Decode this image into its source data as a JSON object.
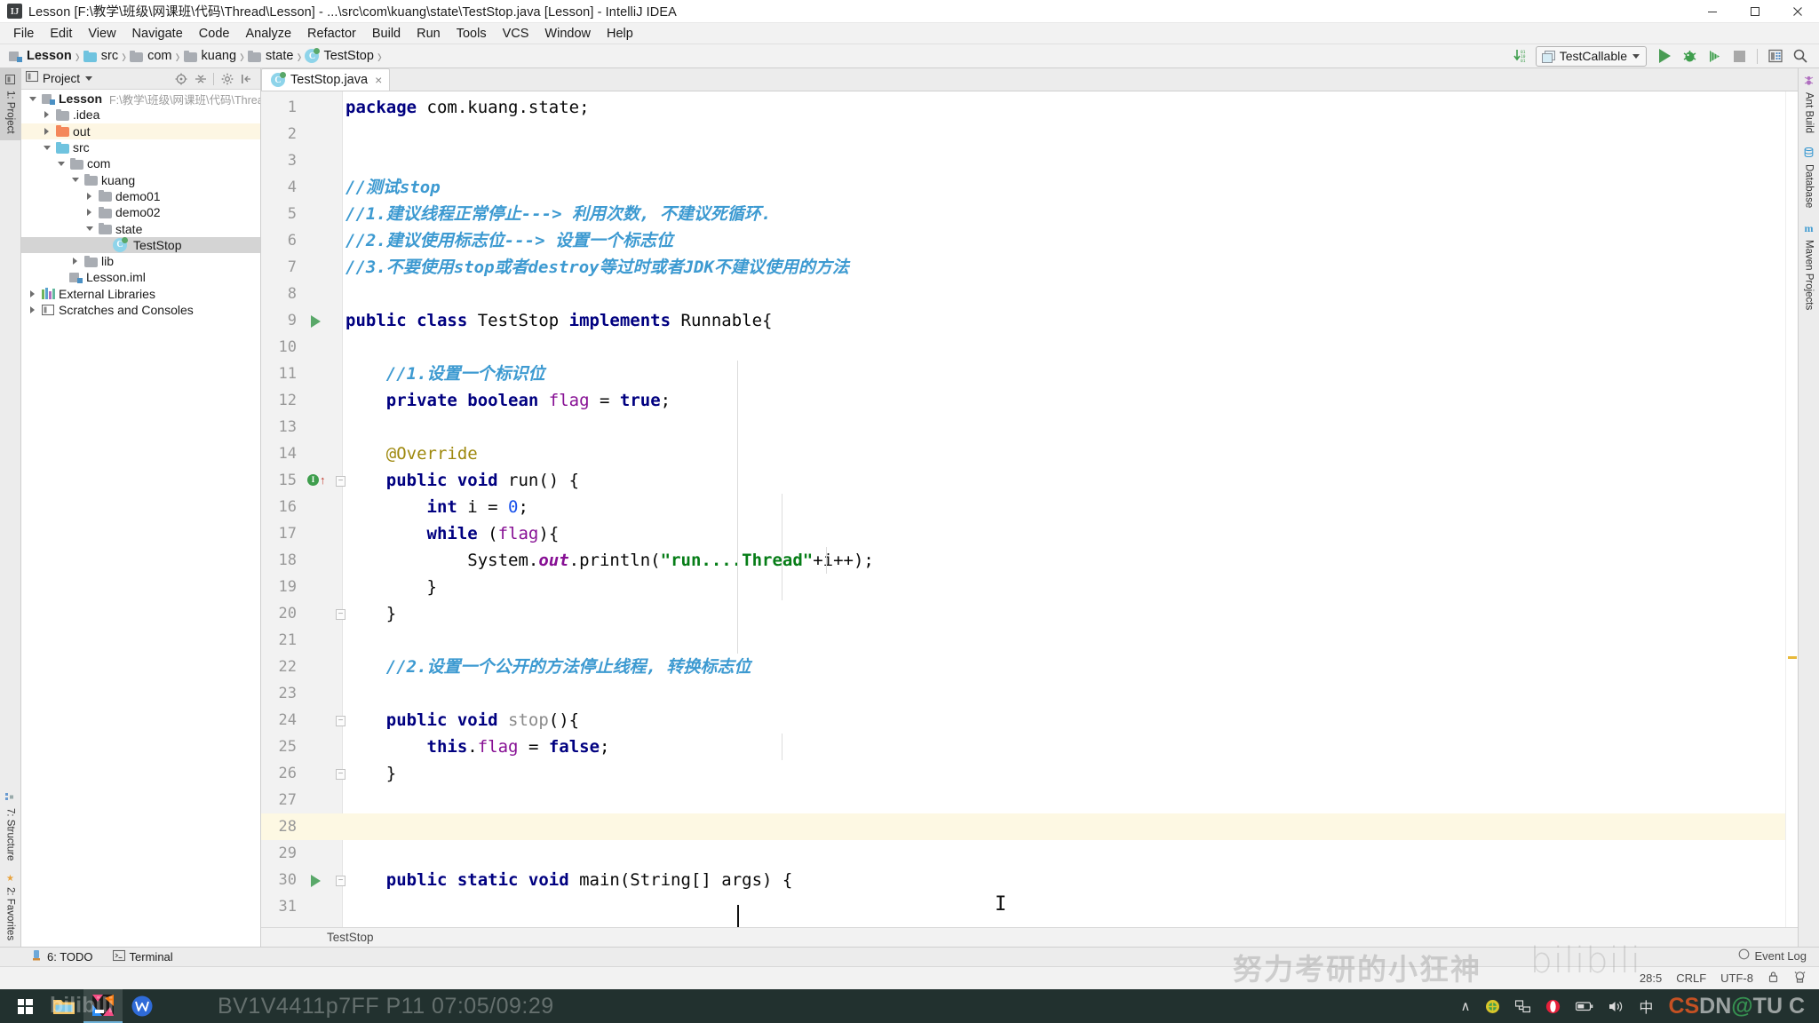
{
  "window": {
    "title": "Lesson [F:\\教学\\班级\\网课班\\代码\\Thread\\Lesson] - ...\\src\\com\\kuang\\state\\TestStop.java [Lesson] - IntelliJ IDEA",
    "app_icon": "intellij-idea-icon",
    "minimize_label": "Minimize",
    "maximize_label": "Maximize",
    "close_label": "Close"
  },
  "menubar": {
    "items": [
      {
        "label": "File"
      },
      {
        "label": "Edit"
      },
      {
        "label": "View"
      },
      {
        "label": "Navigate"
      },
      {
        "label": "Code"
      },
      {
        "label": "Analyze"
      },
      {
        "label": "Refactor"
      },
      {
        "label": "Build"
      },
      {
        "label": "Run"
      },
      {
        "label": "Tools"
      },
      {
        "label": "VCS"
      },
      {
        "label": "Window"
      },
      {
        "label": "Help"
      }
    ]
  },
  "navbar": {
    "breadcrumbs": [
      {
        "label": "Lesson",
        "icon": "module-icon"
      },
      {
        "label": "src",
        "icon": "source-folder-icon"
      },
      {
        "label": "com",
        "icon": "package-icon"
      },
      {
        "label": "kuang",
        "icon": "package-icon"
      },
      {
        "label": "state",
        "icon": "package-icon"
      },
      {
        "label": "TestStop",
        "icon": "java-class-icon"
      }
    ],
    "separator": "›",
    "run_config": "TestCallable",
    "buttons": [
      {
        "name": "compile-button",
        "label": "Build"
      },
      {
        "name": "run-button",
        "label": "Run"
      },
      {
        "name": "debug-button",
        "label": "Debug"
      },
      {
        "name": "run-coverage-button",
        "label": "Run with Coverage"
      },
      {
        "name": "stop-button",
        "label": "Stop"
      },
      {
        "name": "project-structure-button",
        "label": "Project Structure"
      },
      {
        "name": "search-everywhere-button",
        "label": "Search Everywhere"
      }
    ]
  },
  "left_rail": {
    "top": [
      {
        "label": "1: Project",
        "icon": "project-icon",
        "active": true
      }
    ],
    "bottom": [
      {
        "label": "7: Structure",
        "icon": "structure-icon"
      },
      {
        "label": "2: Favorites",
        "icon": "favorites-star-icon"
      }
    ]
  },
  "right_rail": {
    "items": [
      {
        "label": "Ant Build",
        "icon": "ant-icon"
      },
      {
        "label": "Database",
        "icon": "database-icon"
      },
      {
        "label": "Maven Projects",
        "icon": "maven-icon"
      }
    ]
  },
  "project_panel": {
    "title": "Project",
    "header_icons": [
      {
        "name": "locate-icon"
      },
      {
        "name": "collapse-all-icon"
      },
      {
        "name": "settings-gear-icon"
      },
      {
        "name": "hide-panel-icon"
      }
    ],
    "tree": [
      {
        "depth": 0,
        "twisty": "down",
        "icon": "module-icon",
        "label": "Lesson",
        "bold": true,
        "path": "F:\\教学\\班级\\网课班\\代码\\Thread\\Lesson",
        "state": "normal"
      },
      {
        "depth": 1,
        "twisty": "right",
        "icon": "folder-grey",
        "label": ".idea",
        "state": "normal"
      },
      {
        "depth": 1,
        "twisty": "right",
        "icon": "folder-orange",
        "label": "out",
        "state": "highlight"
      },
      {
        "depth": 1,
        "twisty": "down",
        "icon": "folder-blue",
        "label": "src",
        "state": "normal"
      },
      {
        "depth": 2,
        "twisty": "down",
        "icon": "package-icon",
        "label": "com",
        "state": "normal"
      },
      {
        "depth": 3,
        "twisty": "down",
        "icon": "package-icon",
        "label": "kuang",
        "state": "normal"
      },
      {
        "depth": 4,
        "twisty": "right",
        "icon": "package-icon",
        "label": "demo01",
        "state": "normal"
      },
      {
        "depth": 4,
        "twisty": "right",
        "icon": "package-icon",
        "label": "demo02",
        "state": "normal"
      },
      {
        "depth": 4,
        "twisty": "down",
        "icon": "package-icon",
        "label": "state",
        "state": "normal"
      },
      {
        "depth": 5,
        "twisty": "none",
        "icon": "java-class-icon",
        "label": "TestStop",
        "state": "selected"
      },
      {
        "depth": 2,
        "twisty": "right",
        "icon": "package-icon",
        "label": "lib",
        "state": "normal"
      },
      {
        "depth": 2,
        "twisty": "none",
        "icon": "iml-icon",
        "label": "Lesson.iml",
        "state": "normal"
      },
      {
        "depth": 0,
        "twisty": "right",
        "icon": "libraries-icon",
        "label": "External Libraries",
        "state": "normal"
      },
      {
        "depth": 0,
        "twisty": "right",
        "icon": "scratches-icon",
        "label": "Scratches and Consoles",
        "state": "normal"
      }
    ]
  },
  "editor": {
    "tab": {
      "label": "TestStop.java",
      "icon": "java-class-icon",
      "close": "×"
    },
    "breadcrumb": "TestStop",
    "caret_line": 28,
    "lines": [
      {
        "n": 1,
        "segs": [
          {
            "t": "package ",
            "c": "k"
          },
          {
            "t": "com.kuang.state;",
            "c": "plain"
          }
        ]
      },
      {
        "n": 2,
        "segs": []
      },
      {
        "n": 3,
        "segs": []
      },
      {
        "n": 4,
        "segs": [
          {
            "t": "//测试stop",
            "c": "cm"
          }
        ]
      },
      {
        "n": 5,
        "segs": [
          {
            "t": "//1.建议线程正常停止---> 利用次数, 不建议死循环.",
            "c": "cm"
          }
        ]
      },
      {
        "n": 6,
        "segs": [
          {
            "t": "//2.建议使用标志位---> 设置一个标志位",
            "c": "cm"
          }
        ]
      },
      {
        "n": 7,
        "segs": [
          {
            "t": "//3.不要使用stop或者destroy等过时或者JDK不建议使用的方法",
            "c": "cm"
          }
        ]
      },
      {
        "n": 8,
        "segs": []
      },
      {
        "n": 9,
        "segs": [
          {
            "t": "public class ",
            "c": "k"
          },
          {
            "t": "TestStop ",
            "c": "plain"
          },
          {
            "t": "implements ",
            "c": "k"
          },
          {
            "t": "Runnable{",
            "c": "plain"
          }
        ],
        "gutter": "run"
      },
      {
        "n": 10,
        "segs": []
      },
      {
        "n": 11,
        "segs": [
          {
            "t": "    //1.设置一个标识位",
            "c": "cm"
          }
        ]
      },
      {
        "n": 12,
        "segs": [
          {
            "t": "    private boolean ",
            "c": "k"
          },
          {
            "t": "flag ",
            "c": "fld"
          },
          {
            "t": "= ",
            "c": "plain"
          },
          {
            "t": "true",
            "c": "k"
          },
          {
            "t": ";",
            "c": "plain"
          }
        ]
      },
      {
        "n": 13,
        "segs": []
      },
      {
        "n": 14,
        "segs": [
          {
            "t": "    @Override",
            "c": "anno"
          }
        ]
      },
      {
        "n": 15,
        "segs": [
          {
            "t": "    public void ",
            "c": "k"
          },
          {
            "t": "run() {",
            "c": "plain"
          }
        ],
        "gutter": "override"
      },
      {
        "n": 16,
        "segs": [
          {
            "t": "        int ",
            "c": "k"
          },
          {
            "t": "i = ",
            "c": "plain"
          },
          {
            "t": "0",
            "c": "num"
          },
          {
            "t": ";",
            "c": "plain"
          }
        ]
      },
      {
        "n": 17,
        "segs": [
          {
            "t": "        while ",
            "c": "k"
          },
          {
            "t": "(",
            "c": "plain"
          },
          {
            "t": "flag",
            "c": "fld"
          },
          {
            "t": "){",
            "c": "plain"
          }
        ]
      },
      {
        "n": 18,
        "segs": [
          {
            "t": "            System.",
            "c": "plain"
          },
          {
            "t": "out",
            "c": "stat-i"
          },
          {
            "t": ".println(",
            "c": "plain"
          },
          {
            "t": "\"run....Thread\"",
            "c": "str"
          },
          {
            "t": "+i++);",
            "c": "plain"
          }
        ]
      },
      {
        "n": 19,
        "segs": [
          {
            "t": "        }",
            "c": "plain"
          }
        ]
      },
      {
        "n": 20,
        "segs": [
          {
            "t": "    }",
            "c": "plain"
          }
        ],
        "gutter": "fold"
      },
      {
        "n": 21,
        "segs": []
      },
      {
        "n": 22,
        "segs": [
          {
            "t": "    //2.设置一个公开的方法停止线程, 转换标志位",
            "c": "cm"
          }
        ]
      },
      {
        "n": 23,
        "segs": []
      },
      {
        "n": 24,
        "segs": [
          {
            "t": "    public void ",
            "c": "k"
          },
          {
            "t": "stop",
            "c": "stat"
          },
          {
            "t": "(){",
            "c": "plain"
          }
        ],
        "gutter": "fold"
      },
      {
        "n": 25,
        "segs": [
          {
            "t": "        this",
            "c": "k"
          },
          {
            "t": ".",
            "c": "plain"
          },
          {
            "t": "flag ",
            "c": "fld"
          },
          {
            "t": "= ",
            "c": "plain"
          },
          {
            "t": "false",
            "c": "k"
          },
          {
            "t": ";",
            "c": "plain"
          }
        ]
      },
      {
        "n": 26,
        "segs": [
          {
            "t": "    }",
            "c": "plain"
          }
        ],
        "gutter": "fold"
      },
      {
        "n": 27,
        "segs": []
      },
      {
        "n": 28,
        "segs": [],
        "current": true
      },
      {
        "n": 29,
        "segs": []
      },
      {
        "n": 30,
        "segs": [
          {
            "t": "    public static void ",
            "c": "k"
          },
          {
            "t": "main(String[] args) {",
            "c": "plain"
          }
        ],
        "gutter": "runfold"
      },
      {
        "n": 31,
        "segs": []
      }
    ]
  },
  "tool_window_bar": {
    "items": [
      {
        "label": "6: TODO",
        "icon": "todo-icon"
      },
      {
        "label": "Terminal",
        "icon": "terminal-icon"
      }
    ]
  },
  "statusbar": {
    "event_log": "Event Log",
    "caret_position": "28:5",
    "line_separator": "CRLF",
    "encoding": "UTF-8",
    "lock_icon": "read-write-lock-icon",
    "ide_indicator_icon": "hector-inspection-icon"
  },
  "taskbar": {
    "start_label": "Start",
    "items": [
      {
        "name": "taskbar-file-explorer",
        "label": "File Explorer"
      },
      {
        "name": "taskbar-intellij-idea",
        "label": "IntelliJ IDEA",
        "active": true
      },
      {
        "name": "taskbar-wps-office",
        "label": "WPS Office"
      }
    ],
    "tray": [
      {
        "name": "show-hidden-icons",
        "glyph": "∧"
      },
      {
        "name": "security-shield-icon"
      },
      {
        "name": "network-icon"
      },
      {
        "name": "opera-icon"
      },
      {
        "name": "battery-icon"
      },
      {
        "name": "volume-icon"
      },
      {
        "name": "ime-chinese-icon",
        "glyph": "中"
      }
    ]
  },
  "watermarks": {
    "bilibili_logo": "bilibili",
    "bilibili_video": "BV1V4411p7FF P11 07:05/09:29",
    "ide_text": "努力考研的小狂神",
    "ide_text2": "bilibili",
    "csdn": "CSDN@TU C"
  },
  "colors": {
    "accent_green": "#59a869",
    "comment_blue": "#3d9ad1",
    "keyword_navy": "#000080",
    "string_green": "#067d17",
    "field_purple": "#871094",
    "current_line": "#fdf8e3",
    "selection_grey": "#d4d4d4",
    "taskbar_bg": "#22312f"
  }
}
